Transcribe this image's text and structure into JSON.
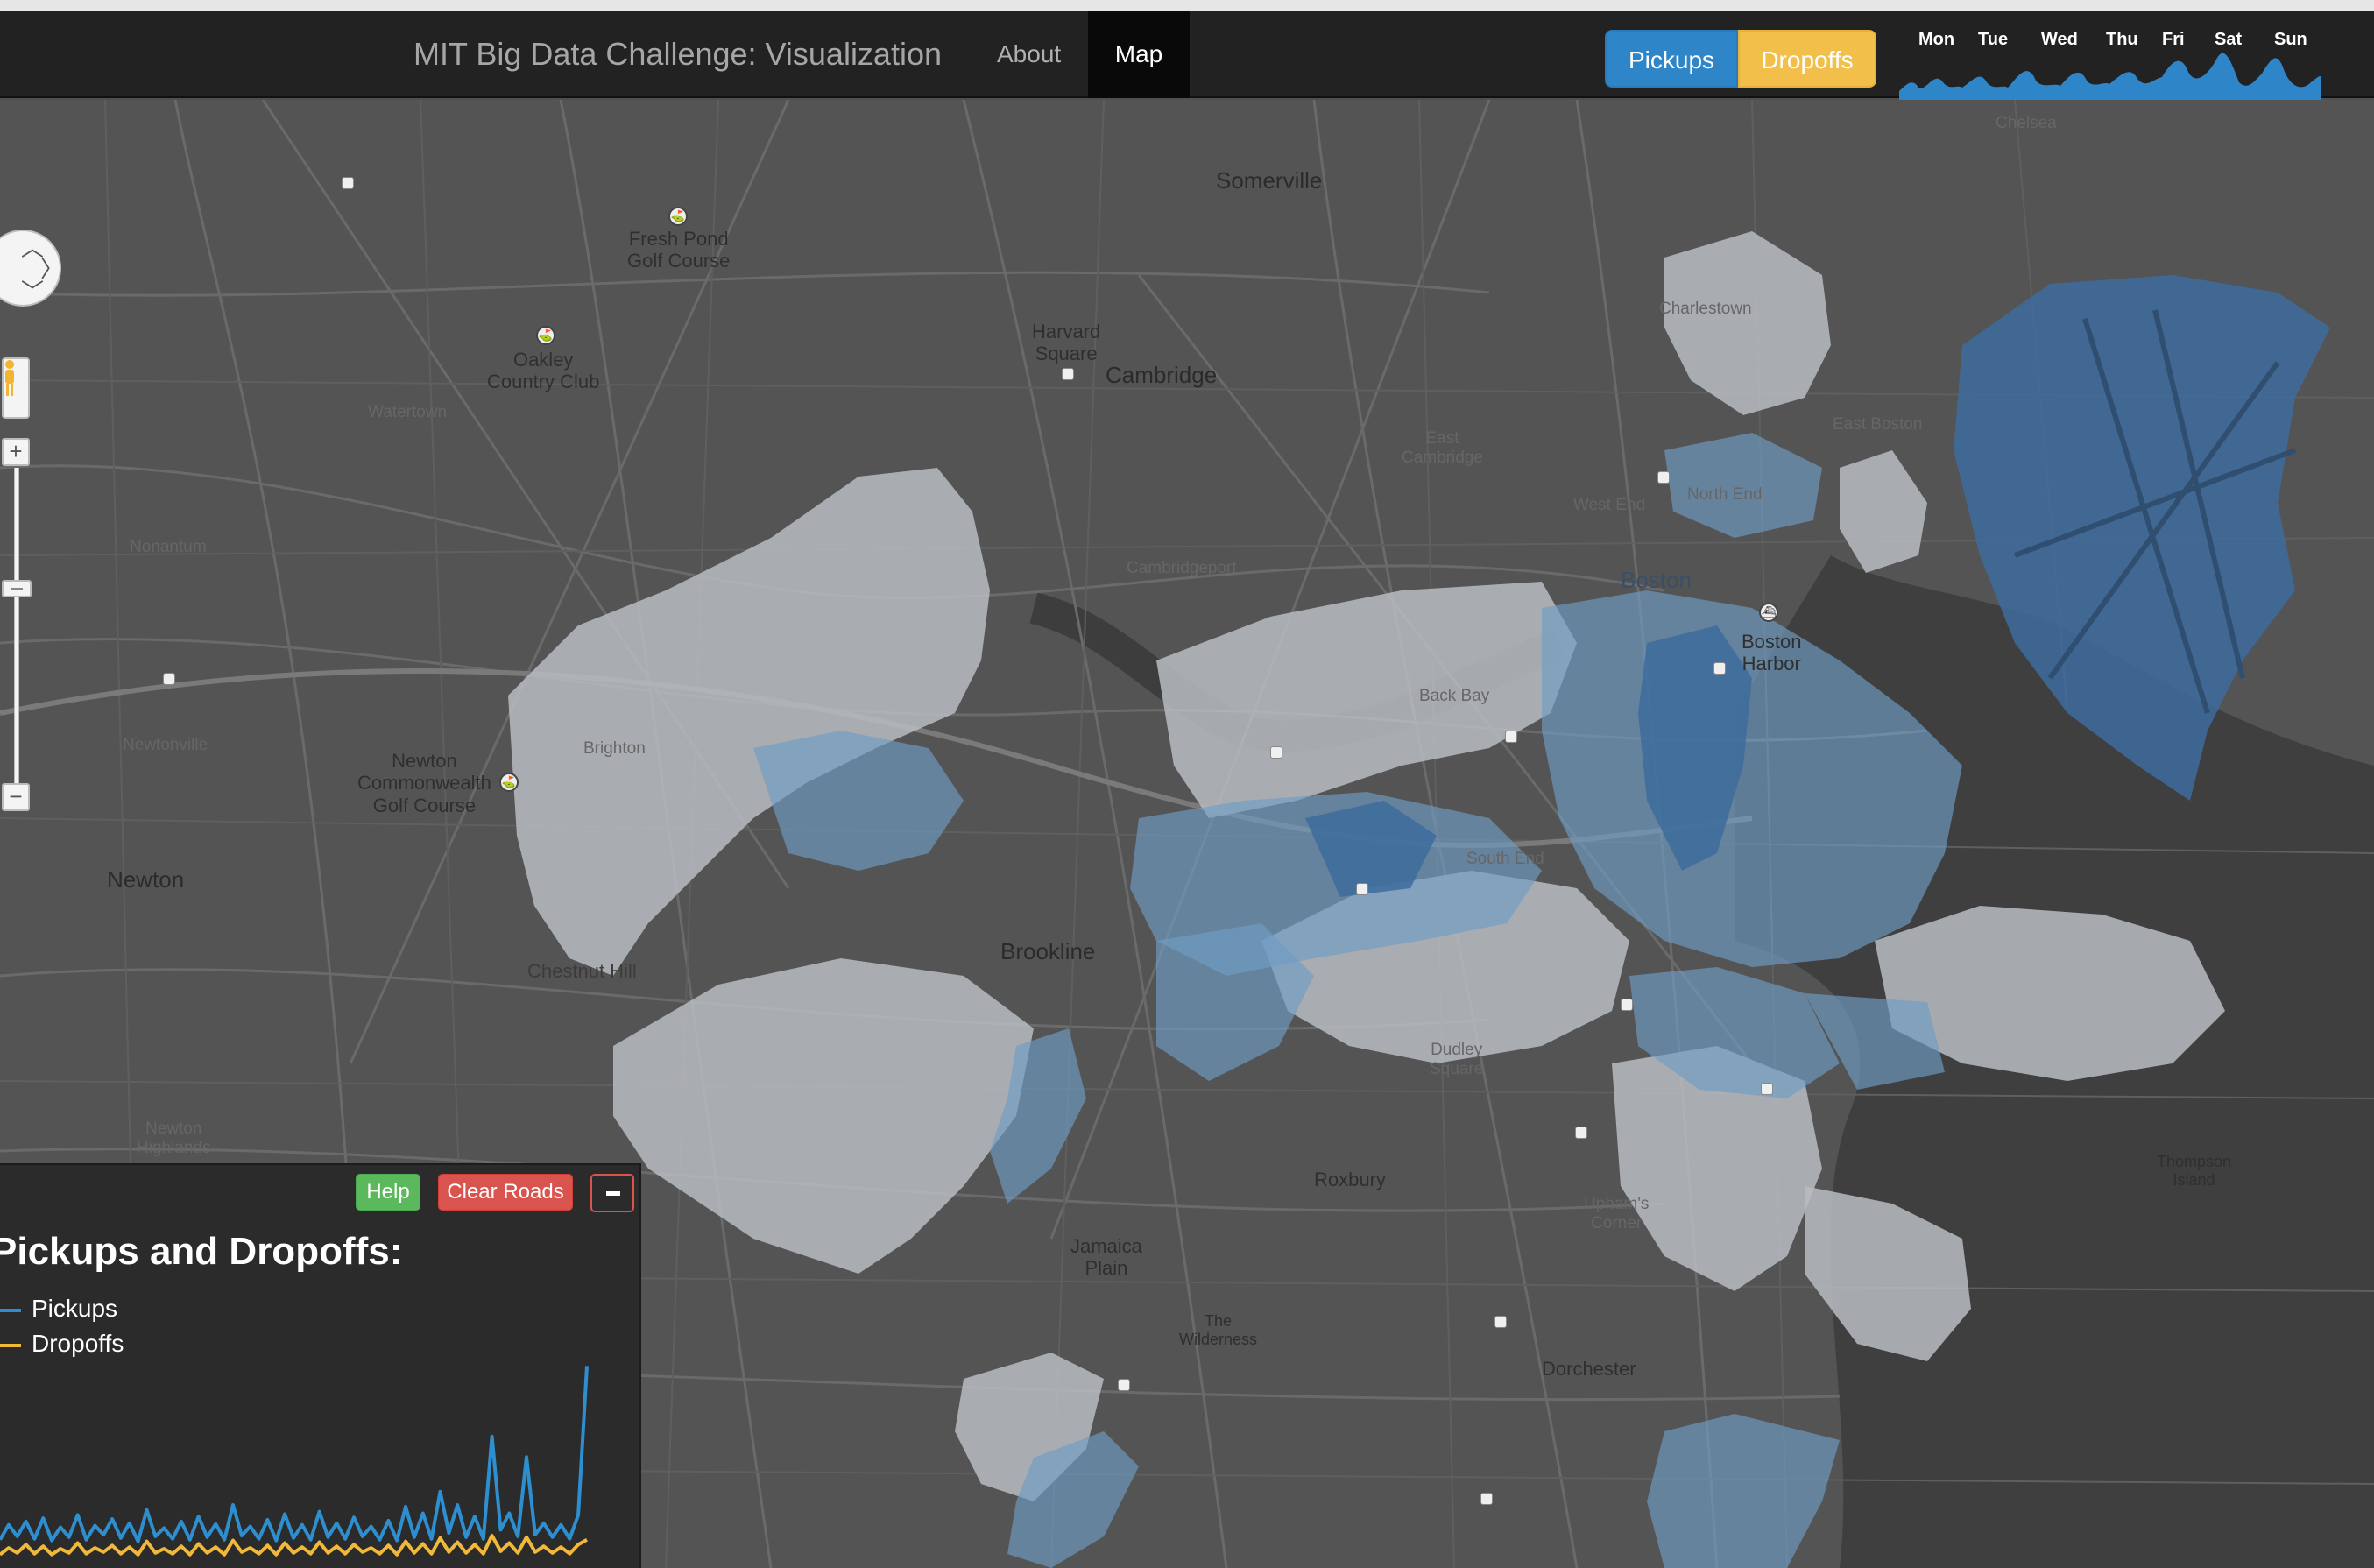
{
  "navbar": {
    "brand": "MIT Big Data Challenge: Visualization",
    "links": [
      {
        "label": "About",
        "active": false
      },
      {
        "label": "Map",
        "active": true
      }
    ],
    "mode_toggle": {
      "pickups_label": "Pickups",
      "dropoffs_label": "Dropoffs",
      "pickups_color": "#2e86c9",
      "dropoffs_color": "#f2c04a"
    },
    "week_chart": {
      "days": [
        "Mon",
        "Tue",
        "Wed",
        "Thu",
        "Fri",
        "Sat",
        "Sun"
      ],
      "color": "#2e86c9"
    }
  },
  "map": {
    "labels": {
      "somerville": "Somerville",
      "fresh_pond": "Fresh Pond\nGolf Course",
      "oakley": "Oakley\nCountry Club",
      "watertown": "Watertown",
      "harvard": "Harvard\nSquare",
      "cambridge": "Cambridge",
      "chelsea": "Chelsea",
      "charlestown": "Charlestown",
      "east_boston": "East Boston",
      "east_cambridge": "East\nCambridge",
      "cambridgeport": "Cambridgeport",
      "boston": "Boston",
      "boston_harbor": "Boston\nHarbor",
      "brighton": "Brighton",
      "newton_cc": "Newton\nCommonwealth\nGolf Course",
      "newton": "Newton",
      "nonantum": "Nonantum",
      "newtonville": "Newtonville",
      "chestnut_hill": "Chestnut Hill",
      "brookline": "Brookline",
      "roxbury": "Roxbury",
      "jamaica_plain": "Jamaica\nPlain",
      "wilderness": "The\nWilderness",
      "dorchester": "Dorchester",
      "thompson": "Thompson\nIsland",
      "back_bay": "Back Bay",
      "south_end": "South End",
      "dudley": "Dudley\nSquare",
      "uphams": "Upham's\nCorner",
      "newton_highlands": "Newton\nHighlands",
      "west_end": "West End",
      "north_end": "North End"
    },
    "controls": {
      "zoom_in": "+",
      "zoom_out": "−"
    }
  },
  "panel": {
    "help_label": "Help",
    "clear_label": "Clear Roads",
    "title": "Pickups and Dropoffs:",
    "legend": [
      {
        "name": "Pickups",
        "color": "#2e8fd0"
      },
      {
        "name": "Dropoffs",
        "color": "#f0b93a"
      }
    ]
  },
  "chart_data": {
    "type": "line",
    "title": "Pickups and Dropoffs:",
    "series": [
      {
        "name": "Pickups",
        "values": [
          30,
          48,
          34,
          52,
          31,
          56,
          29,
          45,
          33,
          60,
          30,
          47,
          36,
          55,
          32,
          50,
          28,
          66,
          34,
          44,
          31,
          52,
          30,
          58,
          33,
          49,
          30,
          72,
          35,
          46,
          31,
          54,
          29,
          61,
          32,
          48,
          30,
          64,
          33,
          50,
          31,
          57,
          34,
          46,
          30,
          53,
          29,
          70,
          33,
          62,
          31,
          88,
          38,
          72,
          33,
          58,
          31,
          155,
          42,
          62,
          34,
          130,
          36,
          50,
          33,
          48,
          31,
          60,
          240
        ]
      },
      {
        "name": "Dropoffs",
        "values": [
          12,
          20,
          14,
          24,
          13,
          22,
          12,
          19,
          14,
          26,
          13,
          20,
          15,
          23,
          13,
          21,
          12,
          28,
          14,
          19,
          13,
          22,
          12,
          25,
          14,
          21,
          12,
          29,
          15,
          20,
          13,
          23,
          12,
          26,
          14,
          21,
          13,
          27,
          14,
          22,
          13,
          24,
          15,
          20,
          13,
          23,
          12,
          28,
          14,
          25,
          13,
          32,
          15,
          27,
          14,
          24,
          13,
          35,
          16,
          26,
          14,
          33,
          15,
          22,
          14,
          21,
          13,
          24,
          30
        ]
      }
    ],
    "legend": "top-left",
    "grid": false
  }
}
